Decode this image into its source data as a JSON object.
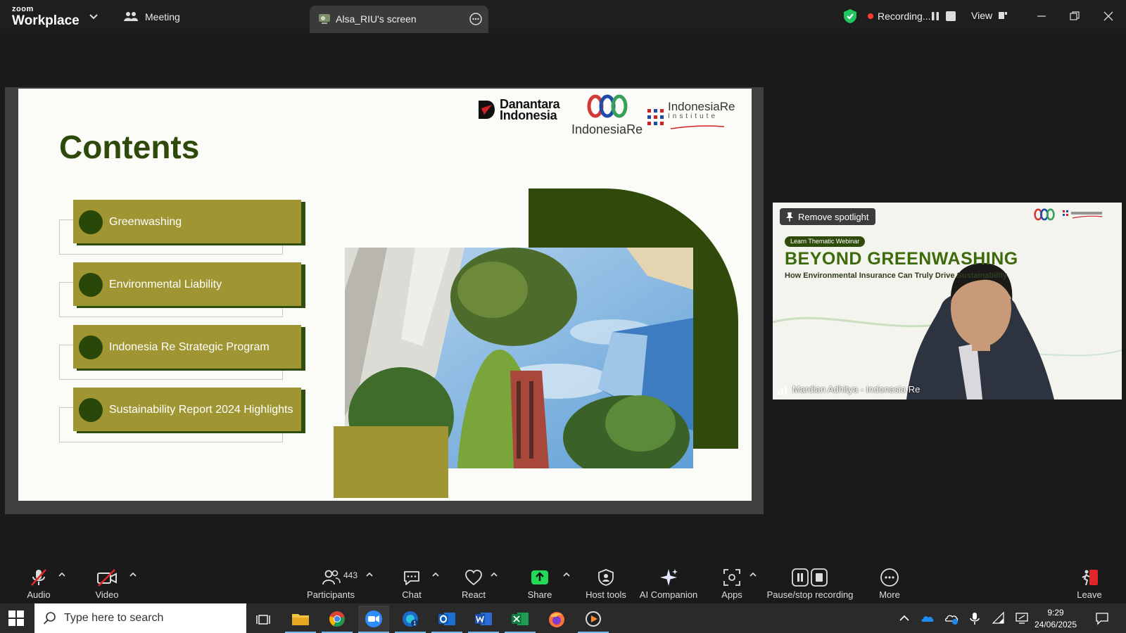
{
  "titlebar": {
    "brand_small": "zoom",
    "brand_big": "Workplace",
    "meeting_label": "Meeting",
    "share_tab_label": "Alsa_RIU's screen",
    "recording_label": "Recording...",
    "view_label": "View"
  },
  "slide": {
    "title": "Contents",
    "logos": {
      "danantara": "Danantara\nIndonesia",
      "indonesia_re": "IndonesiaRe",
      "institute_main": "IndonesiaRe",
      "institute_sub": "Institute"
    },
    "items": [
      {
        "label": "Greenwashing"
      },
      {
        "label": "Environmental Liability"
      },
      {
        "label": "Indonesia Re Strategic Program"
      },
      {
        "label": "Sustainability Report 2024 Highlights"
      }
    ]
  },
  "video_tile": {
    "remove_spotlight": "Remove spotlight",
    "badge": "Learn Thematic Webinar",
    "title": "BEYOND GREENWASHING",
    "subtitle": "How Environmental Insurance Can Truly Drive Sustainability",
    "participant_name": "Mardian Adhitya - Indonesia Re"
  },
  "toolbar": {
    "audio": "Audio",
    "video": "Video",
    "participants": "Participants",
    "participants_count": "443",
    "chat": "Chat",
    "react": "React",
    "share": "Share",
    "host_tools": "Host tools",
    "ai_companion": "AI Companion",
    "apps": "Apps",
    "pause_stop_recording": "Pause/stop recording",
    "more": "More",
    "leave": "Leave"
  },
  "taskbar": {
    "search_placeholder": "Type here to search",
    "time": "9:29",
    "date": "24/06/2025"
  },
  "colors": {
    "slide_dark_green": "#2f4a0a",
    "slide_olive": "#9f9633",
    "share_green": "#23d959",
    "leave_red": "#e0262a",
    "recording_red": "#ff3b30"
  },
  "icons": [
    "zoom-logo",
    "chevron-down-icon",
    "meeting-icon",
    "screen-share-icon",
    "more-icon",
    "shield-check-icon",
    "pause-icon",
    "stop-icon",
    "minimize-icon",
    "restore-icon",
    "close-icon",
    "mic-off-icon",
    "video-off-icon",
    "participants-icon",
    "chat-icon",
    "react-icon",
    "share-icon",
    "host-tools-icon",
    "ai-sparkle-icon",
    "apps-icon",
    "pause-stop-icon",
    "more-dots-icon",
    "leave-icon",
    "windows-start-icon",
    "search-icon"
  ]
}
